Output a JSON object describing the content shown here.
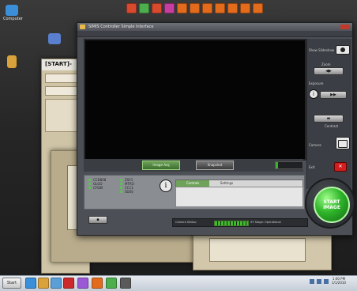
{
  "desktop": {
    "icons": [
      {
        "label": "Computer",
        "icon": "computer-icon",
        "color": "#3a8fd8"
      },
      {
        "label": "",
        "icon": "recycle-bin-icon",
        "color": "#d9a23a"
      },
      {
        "label": "",
        "icon": "network-icon",
        "color": "#5a7fcf"
      }
    ]
  },
  "quick_launch": {
    "colors": [
      "#d84a2e",
      "#4cae4c",
      "#d84a2e",
      "#c83ea0",
      "#e36b1c",
      "#e36b1c",
      "#e36b1c",
      "#e36b1c",
      "#e36b1c",
      "#e36b1c",
      "#e36b1c"
    ]
  },
  "background_windows": {
    "back_title": "[START]-",
    "back_fields": [
      "",
      "",
      ""
    ]
  },
  "app": {
    "title": "SIMIS Controller Simple Interface",
    "ctrl": {
      "green_btn_label": "Image Acq",
      "dark_btn_label": "Snapshot"
    },
    "side": {
      "labels": [
        "Show Slideshow",
        "Zoom",
        "Exposure",
        "Contrast",
        "Camera",
        "Exit"
      ]
    },
    "bottom": {
      "status_rows": [
        "CCD808",
        "GLGO",
        "CFS0ll"
      ],
      "status_col2": [
        "ZSY1",
        "MTRO",
        "CCC1",
        "SDSS"
      ],
      "info_symbol": "i",
      "tab_active": "Controls",
      "tab_inactive": "Settings"
    },
    "small_button": "▪",
    "status_left": "Camera Status:",
    "status_right": "XY Stage: Operational",
    "start_button": "START\nIMAGE",
    "accent_green": "#3fae2a",
    "accent_red": "#d01f1f"
  },
  "taskbar": {
    "start_label": "Start",
    "icon_colors": [
      "#3a8fd8",
      "#d9a23a",
      "#5a9fd8",
      "#cc2a2a",
      "#9b59d6",
      "#e36b1c",
      "#4cae4c",
      "#5a5a5a"
    ],
    "clock_time": "1:00 PM",
    "clock_date": "1/1/2010"
  }
}
